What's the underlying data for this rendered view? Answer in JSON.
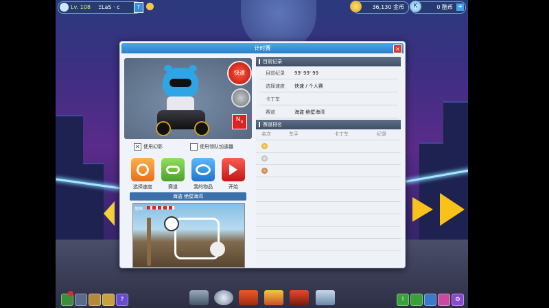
{
  "topbar": {
    "level": "Lv. 108",
    "player_name": "ΞLaS · c",
    "gold": "36,130 金币",
    "kcash": "0 酷币"
  },
  "dialog": {
    "title": "计时赛",
    "close_label": "×"
  },
  "kart_view": {
    "speed_button": "快速",
    "no_badge": "N",
    "no_badge_sub": "0"
  },
  "options": [
    {
      "label": "使用幻影",
      "checked": true
    },
    {
      "label": "使用领队加速器",
      "checked": false
    }
  ],
  "actions": [
    {
      "label": "选择速度",
      "icon": "speed-icon",
      "color": "#f07d1e"
    },
    {
      "label": "赛道",
      "icon": "track-icon",
      "color": "#5fb43a"
    },
    {
      "label": "我的物品",
      "icon": "items-icon",
      "color": "#2f8fe0"
    },
    {
      "label": "开始",
      "icon": "start-icon",
      "color": "#e0302d"
    }
  ],
  "track": {
    "name": "海盗 绝壁海湾",
    "preview_label": "地图"
  },
  "records": {
    "header": "目前记录",
    "rows": [
      {
        "key": "目前纪录",
        "value": "99' 99' 99"
      },
      {
        "key": "选择速度",
        "value": "快速 / 个人赛"
      },
      {
        "key": "卡丁车",
        "value": ""
      },
      {
        "key": "赛道",
        "value": "海盗 绝壁海湾"
      }
    ]
  },
  "ranking": {
    "header": "赛道排名",
    "columns": [
      "名次",
      "车手",
      "卡丁车",
      "纪录"
    ],
    "medals": [
      "gold-medal-icon",
      "silver-medal-icon",
      "bronze-medal-icon"
    ]
  },
  "colors": {
    "title_blue": "#2b7fc9",
    "section_header": "#4a5b72"
  }
}
